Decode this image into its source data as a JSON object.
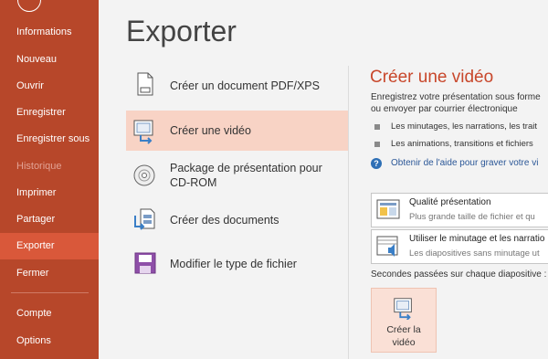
{
  "sidebar": {
    "items": [
      {
        "label": "Informations"
      },
      {
        "label": "Nouveau"
      },
      {
        "label": "Ouvrir"
      },
      {
        "label": "Enregistrer"
      },
      {
        "label": "Enregistrer sous"
      },
      {
        "label": "Historique",
        "disabled": true
      },
      {
        "label": "Imprimer"
      },
      {
        "label": "Partager"
      },
      {
        "label": "Exporter",
        "active": true
      },
      {
        "label": "Fermer"
      },
      {
        "label": "Compte"
      },
      {
        "label": "Options"
      }
    ]
  },
  "page": {
    "title": "Exporter"
  },
  "export_options": [
    {
      "label": "Créer un document PDF/XPS",
      "icon": "pdf-document-icon"
    },
    {
      "label": "Créer une vidéo",
      "icon": "video-icon",
      "active": true
    },
    {
      "label_line1": "Package de présentation pour",
      "label_line2": "CD-ROM",
      "icon": "cd-rom-icon"
    },
    {
      "label": "Créer des documents",
      "icon": "handouts-icon"
    },
    {
      "label": "Modifier le type de fichier",
      "icon": "file-type-icon"
    }
  ],
  "detail": {
    "title": "Créer une vidéo",
    "desc_line1": "Enregistrez votre présentation sous forme",
    "desc_line2": "ou envoyer par courrier électronique",
    "bullets": [
      "Les minutages, les narrations, les trait",
      "Les animations, transitions et fichiers"
    ],
    "help_link": "Obtenir de l'aide pour graver votre vi",
    "quality": {
      "title": "Qualité présentation",
      "subtitle": "Plus grande taille de fichier et qu"
    },
    "timing": {
      "title": "Utiliser le minutage et les narratio",
      "subtitle": "Les diapositives sans minutage ut"
    },
    "seconds_label": "Secondes passées sur chaque diapositive :",
    "create_button": {
      "line1": "Créer la",
      "line2": "vidéo"
    }
  },
  "colors": {
    "sidebar": "#b7472a",
    "sidebar_active": "#d9583a",
    "accent": "#c8472b",
    "link": "#2b5797"
  }
}
